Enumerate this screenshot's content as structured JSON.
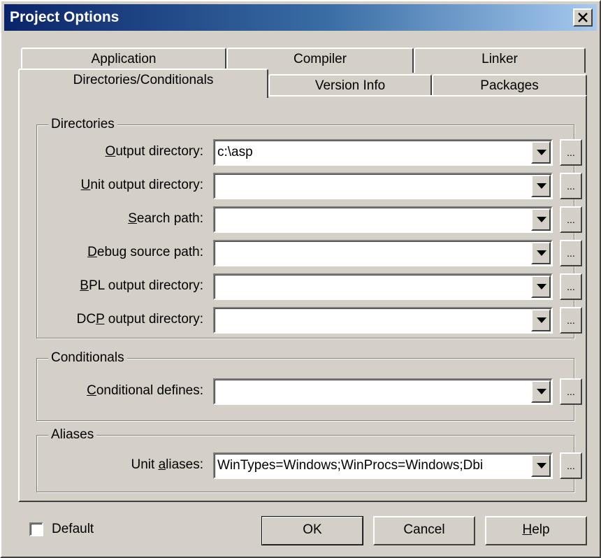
{
  "window": {
    "title": "Project Options"
  },
  "tabs": {
    "row_back": [
      "Application",
      "Compiler",
      "Linker"
    ],
    "row_front": [
      "Directories/Conditionals",
      "Version Info",
      "Packages"
    ],
    "active": "Directories/Conditionals"
  },
  "directories": {
    "title": "Directories",
    "output_dir": {
      "pre": "",
      "key": "O",
      "post": "utput directory:",
      "value": "c:\\asp"
    },
    "unit_output_dir": {
      "pre": "",
      "key": "U",
      "post": "nit output directory:",
      "value": ""
    },
    "search_path": {
      "pre": "",
      "key": "S",
      "post": "earch path:",
      "value": ""
    },
    "debug_source_path": {
      "pre": "",
      "key": "D",
      "post": "ebug source path:",
      "value": ""
    },
    "bpl_output_dir": {
      "pre": "",
      "key": "B",
      "post": "PL output directory:",
      "value": ""
    },
    "dcp_output_dir": {
      "pre": "DC",
      "key": "P",
      "post": " output directory:",
      "value": ""
    }
  },
  "conditionals": {
    "title": "Conditionals",
    "defines": {
      "pre": "",
      "key": "C",
      "post": "onditional defines:",
      "value": ""
    }
  },
  "aliases": {
    "title": "Aliases",
    "unit_aliases": {
      "pre": "Unit ",
      "key": "a",
      "post": "liases:",
      "value": "WinTypes=Windows;WinProcs=Windows;Dbi"
    }
  },
  "browse_label": "...",
  "footer": {
    "default_label": "Default",
    "default_checked": false,
    "ok_label": "OK",
    "cancel_label": "Cancel",
    "help": {
      "key": "H",
      "post": "elp"
    }
  },
  "icons": {
    "close": "close-icon",
    "dropdown": "chevron-down-icon"
  }
}
